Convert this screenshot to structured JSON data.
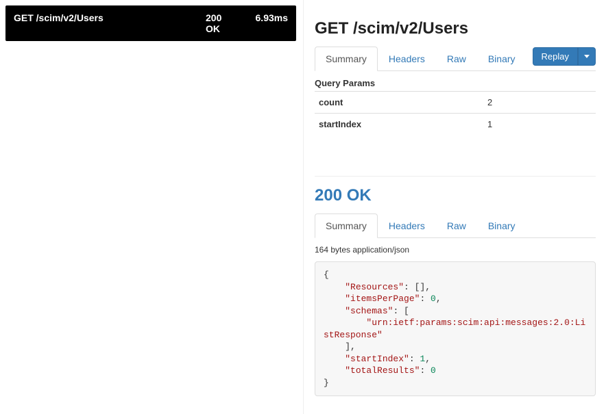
{
  "left": {
    "rows": [
      {
        "title": "GET /scim/v2/Users",
        "status_code": "200",
        "status_text": "OK",
        "time": "6.93ms"
      }
    ]
  },
  "request": {
    "title": "GET /scim/v2/Users",
    "tabs": [
      "Summary",
      "Headers",
      "Raw",
      "Binary"
    ],
    "replay_label": "Replay",
    "query_params_label": "Query Params",
    "params": [
      {
        "key": "count",
        "value": "2"
      },
      {
        "key": "startIndex",
        "value": "1"
      }
    ]
  },
  "response": {
    "status_heading": "200 OK",
    "tabs": [
      "Summary",
      "Headers",
      "Raw",
      "Binary"
    ],
    "size_label": "164 bytes application/json",
    "body_tokens": [
      {
        "t": "{",
        "c": ""
      },
      {
        "t": "\n    ",
        "c": ""
      },
      {
        "t": "\"Resources\"",
        "c": "str"
      },
      {
        "t": ": [],\n    ",
        "c": ""
      },
      {
        "t": "\"itemsPerPage\"",
        "c": "str"
      },
      {
        "t": ": ",
        "c": ""
      },
      {
        "t": "0",
        "c": "num"
      },
      {
        "t": ",\n    ",
        "c": ""
      },
      {
        "t": "\"schemas\"",
        "c": "str"
      },
      {
        "t": ": [\n        ",
        "c": ""
      },
      {
        "t": "\"urn:ietf:params:scim:api:messages:2.0:ListResponse\"",
        "c": "str"
      },
      {
        "t": "\n    ],\n    ",
        "c": ""
      },
      {
        "t": "\"startIndex\"",
        "c": "str"
      },
      {
        "t": ": ",
        "c": ""
      },
      {
        "t": "1",
        "c": "num"
      },
      {
        "t": ",\n    ",
        "c": ""
      },
      {
        "t": "\"totalResults\"",
        "c": "str"
      },
      {
        "t": ": ",
        "c": ""
      },
      {
        "t": "0",
        "c": "num"
      },
      {
        "t": "\n}",
        "c": ""
      }
    ]
  }
}
